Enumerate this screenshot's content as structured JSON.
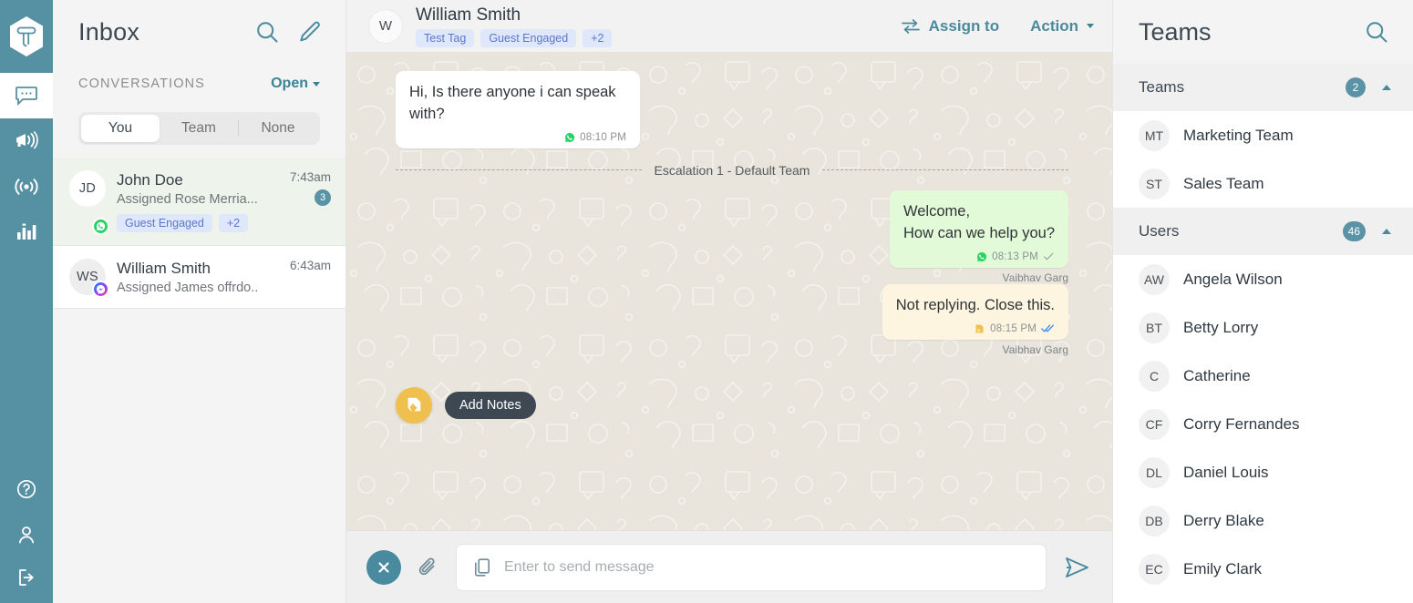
{
  "brand": {
    "logo_icon": "hexagon-t-logo",
    "accent": "#5590a3"
  },
  "rail": {
    "items": [
      {
        "name": "conversations",
        "icon": "chat-bubble-icon",
        "active": true
      },
      {
        "name": "campaigns",
        "icon": "megaphone-icon",
        "active": false
      },
      {
        "name": "broadcast",
        "icon": "broadcast-signal-icon",
        "active": false
      },
      {
        "name": "analytics",
        "icon": "bar-chart-icon",
        "active": false
      }
    ],
    "bottom_items": [
      {
        "name": "help",
        "icon": "question-circle-icon"
      },
      {
        "name": "profile",
        "icon": "person-icon"
      },
      {
        "name": "logout",
        "icon": "logout-icon"
      }
    ]
  },
  "inbox": {
    "title": "Inbox",
    "search_icon": "search-icon",
    "compose_icon": "pencil-icon",
    "section_label": "CONVERSATIONS",
    "filter_label": "Open",
    "tabs": [
      {
        "label": "You",
        "active": true
      },
      {
        "label": "Team",
        "active": false
      },
      {
        "label": "None",
        "active": false
      }
    ],
    "conversations": [
      {
        "initials": "JD",
        "name": "John Doe",
        "preview": "Assigned Rose Merria...",
        "time": "7:43am",
        "unread": "3",
        "channel": "whatsapp",
        "tags": [
          "Guest Engaged",
          "+2"
        ],
        "selected": true
      },
      {
        "initials": "WS",
        "name": "William Smith",
        "preview": "Assigned James offrdo..",
        "time": "6:43am",
        "unread": "",
        "channel": "messenger",
        "tags": [],
        "selected": false
      }
    ]
  },
  "chat": {
    "avatar_initial": "W",
    "contact_name": "William Smith",
    "tags": [
      "Test Tag",
      "Guest Engaged",
      "+2"
    ],
    "assign_label": "Assign to",
    "assign_icon": "transfer-arrows-icon",
    "action_label": "Action",
    "messages": [
      {
        "kind": "incoming",
        "text": "Hi, Is there anyone i can speak with?",
        "time": "08:10 PM",
        "channel_icon": "whatsapp-icon",
        "status": "",
        "sender": ""
      },
      {
        "kind": "divider",
        "text": "Escalation 1 - Default Team"
      },
      {
        "kind": "outgoing",
        "text": "Welcome,\nHow can we help you?",
        "time": "08:13 PM",
        "channel_icon": "whatsapp-icon",
        "status": "single-check",
        "sender": "Vaibhav Garg"
      },
      {
        "kind": "note",
        "text": "Not replying. Close this.",
        "time": "08:15 PM",
        "channel_icon": "note-icon",
        "status": "double-check",
        "sender": "Vaibhav Garg"
      }
    ],
    "notes_fab_icon": "sticky-note-icon",
    "notes_tooltip": "Add Notes",
    "composer": {
      "close_icon": "close-circle-icon",
      "attach_icon": "paperclip-icon",
      "template_icon": "copy-pages-icon",
      "placeholder": "Enter to send message",
      "value": "",
      "send_icon": "send-plane-icon"
    }
  },
  "right_panel": {
    "title": "Teams",
    "search_icon": "search-icon",
    "sections": [
      {
        "name": "Teams",
        "count": "2",
        "expanded": true,
        "items": [
          {
            "initials": "MT",
            "name": "Marketing Team"
          },
          {
            "initials": "ST",
            "name": "Sales Team"
          }
        ]
      },
      {
        "name": "Users",
        "count": "46",
        "expanded": true,
        "items": [
          {
            "initials": "AW",
            "name": "Angela Wilson"
          },
          {
            "initials": "BT",
            "name": "Betty Lorry"
          },
          {
            "initials": "C",
            "name": "Catherine"
          },
          {
            "initials": "CF",
            "name": "Corry Fernandes"
          },
          {
            "initials": "DL",
            "name": "Daniel Louis"
          },
          {
            "initials": "DB",
            "name": "Derry Blake"
          },
          {
            "initials": "EC",
            "name": "Emily Clark"
          }
        ]
      }
    ]
  }
}
